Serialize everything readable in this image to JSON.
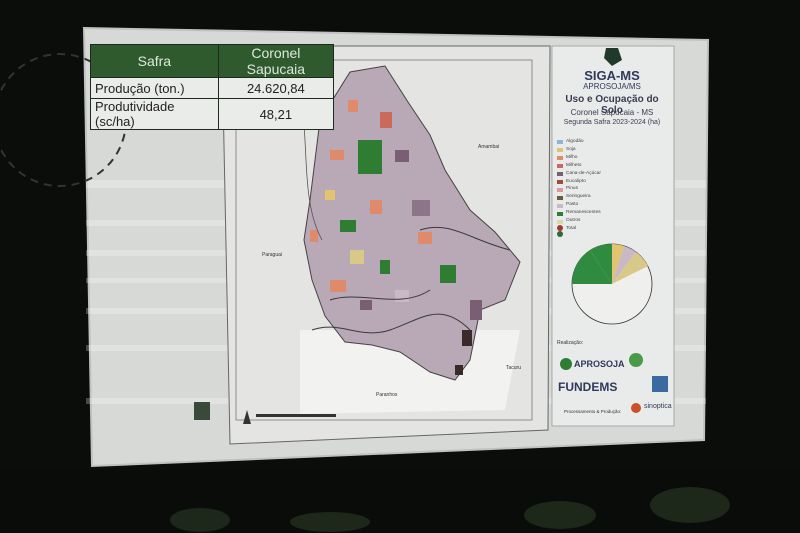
{
  "table": {
    "header": [
      "Safra",
      "Coronel Sapucaia"
    ],
    "rows": [
      {
        "label": "Produção (ton.)",
        "value": "24.620,84"
      },
      {
        "label": "Produtividade (sc/ha)",
        "value": "48,21"
      }
    ]
  },
  "brand": {
    "name": "SIGA-MS",
    "sub": "APROSOJA/MS"
  },
  "map_title": "Uso e Ocupação do Solo",
  "map_subtitle": "Coronel Sapucaia - MS",
  "map_season": "Segunda Safra 2023-2024 (ha)",
  "place_labels": {
    "amambai": "Amambai",
    "paraguai": "Paraguai",
    "paranhos": "Paranhos",
    "tacuru": "Tacuru"
  },
  "legend_items": [
    "Algodão",
    "Soja",
    "Milho",
    "Milheto",
    "Cana-de-Açúcar",
    "Eucalipto",
    "Pinus",
    "Seringueira",
    "Pasto",
    "Remanescentes",
    "Outros",
    "Total"
  ],
  "realizacao": "Realização:",
  "logos": {
    "aprosoja": "APROSOJA",
    "fundems": "FUNDEMS",
    "sinoptica": "sinoptica"
  },
  "footer": "Processamento & Produção:",
  "colors": {
    "accent_green": "#2f5a2e",
    "map_green": "#2e7d32",
    "pie_green": "#2e8b3f"
  }
}
